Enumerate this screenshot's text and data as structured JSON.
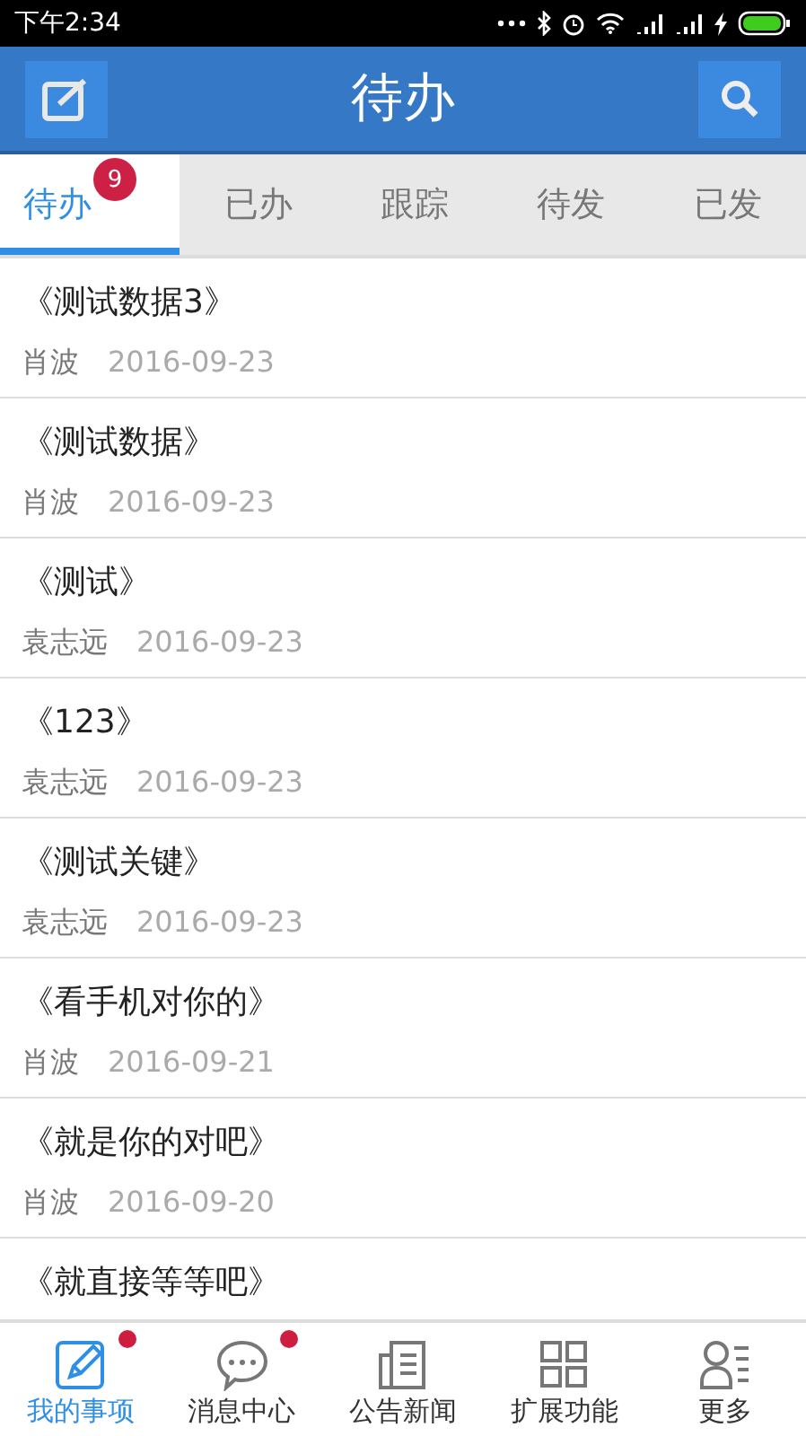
{
  "status_bar": {
    "time": "下午2:34"
  },
  "header": {
    "title": "待办"
  },
  "tabs": [
    {
      "label": "待办",
      "selected": true,
      "badge": "9"
    },
    {
      "label": "已办",
      "selected": false
    },
    {
      "label": "跟踪",
      "selected": false
    },
    {
      "label": "待发",
      "selected": false
    },
    {
      "label": "已发",
      "selected": false
    }
  ],
  "items": [
    {
      "title": "《测试数据3》",
      "author": "肖波",
      "date": "2016-09-23"
    },
    {
      "title": "《测试数据》",
      "author": "肖波",
      "date": "2016-09-23"
    },
    {
      "title": "《测试》",
      "author": "袁志远",
      "date": "2016-09-23"
    },
    {
      "title": "《123》",
      "author": "袁志远",
      "date": "2016-09-23"
    },
    {
      "title": "《测试关键》",
      "author": "袁志远",
      "date": "2016-09-23"
    },
    {
      "title": "《看手机对你的》",
      "author": "肖波",
      "date": "2016-09-21"
    },
    {
      "title": "《就是你的对吧》",
      "author": "肖波",
      "date": "2016-09-20"
    },
    {
      "title": "《就直接等等吧》"
    }
  ],
  "nav": [
    {
      "kind": "pencil",
      "label": "我的事项",
      "selected": true,
      "dot": true
    },
    {
      "kind": "chat",
      "label": "消息中心",
      "selected": false,
      "dot": true
    },
    {
      "kind": "news",
      "label": "公告新闻",
      "selected": false,
      "dot": false
    },
    {
      "kind": "grid",
      "label": "扩展功能",
      "selected": false,
      "dot": false
    },
    {
      "kind": "person",
      "label": "更多",
      "selected": false,
      "dot": false
    }
  ]
}
